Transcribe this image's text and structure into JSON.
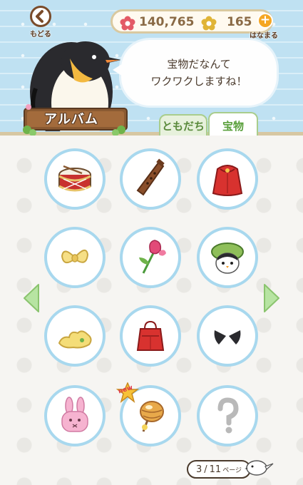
{
  "header": {
    "back_label": "もどる",
    "currency": [
      {
        "icon": "red-flower-icon",
        "value": "140,765",
        "color": "#e35a66"
      },
      {
        "icon": "yellow-flower-icon",
        "value": "165",
        "color": "#e0b437"
      }
    ],
    "plus_label": "+",
    "hanamaru_label": "はなまる",
    "speech_lines": [
      "宝物だなんて",
      "ワクワクしますね！"
    ],
    "album_title": "アルバム"
  },
  "tabs": [
    {
      "label": "ともだち",
      "active": false
    },
    {
      "label": "宝物",
      "active": true
    }
  ],
  "items": [
    {
      "name": "drum-item",
      "row": 0,
      "col": 0
    },
    {
      "name": "recorder-flute-item",
      "row": 0,
      "col": 1
    },
    {
      "name": "red-cape-item",
      "row": 0,
      "col": 2
    },
    {
      "name": "yellow-bow-item",
      "row": 1,
      "col": 0
    },
    {
      "name": "pink-flower-item",
      "row": 1,
      "col": 1
    },
    {
      "name": "green-hat-penguin-item",
      "row": 1,
      "col": 2
    },
    {
      "name": "yellow-cloth-item",
      "row": 2,
      "col": 0
    },
    {
      "name": "red-bag-item",
      "row": 2,
      "col": 1
    },
    {
      "name": "black-ears-item",
      "row": 2,
      "col": 2
    },
    {
      "name": "pink-bunny-item",
      "row": 3,
      "col": 0
    },
    {
      "name": "honey-dipper-item",
      "row": 3,
      "col": 1,
      "new": true
    },
    {
      "name": "unknown-item",
      "row": 3,
      "col": 2
    }
  ],
  "new_badge_label": "new",
  "pagination": {
    "current": "3",
    "separator": "/",
    "total": "11",
    "suffix": "ページ"
  },
  "colors": {
    "slot_border": "#a8d8ee",
    "arrow_green": "#b7e4a2",
    "header_blue": "#bfe1f2",
    "tab_green": "#a9cd8c"
  }
}
